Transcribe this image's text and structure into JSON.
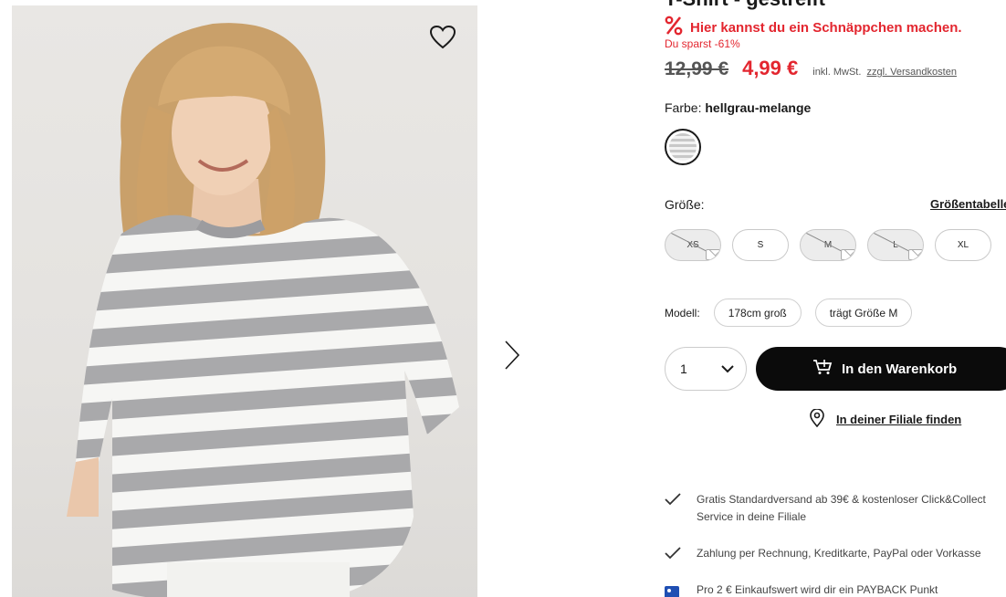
{
  "product": {
    "title": "T-Shirt - gestreift",
    "deal_text": "Hier kannst du ein Schnäppchen machen.",
    "savings": "Du sparst -61%",
    "old_price": "12,99 €",
    "new_price": "4,99 €",
    "tax_note": "inkl. MwSt.",
    "shipping_link": "zzgl. Versandkosten"
  },
  "color": {
    "label": "Farbe:",
    "value": "hellgrau-melange"
  },
  "size": {
    "label": "Größe:",
    "table_link": "Größentabelle",
    "options": [
      {
        "label": "XS",
        "available": false
      },
      {
        "label": "S",
        "available": true
      },
      {
        "label": "M",
        "available": false
      },
      {
        "label": "L",
        "available": false
      },
      {
        "label": "XL",
        "available": true
      }
    ]
  },
  "model": {
    "label": "Modell:",
    "height": "178cm groß",
    "size_worn": "trägt Größe M"
  },
  "cart": {
    "quantity": "1",
    "add_label": "In den Warenkorb",
    "store_link": "In deiner Filiale finden"
  },
  "usps": [
    {
      "icon": "check-icon",
      "text": "Gratis Standardversand ab 39€ & kostenloser Click&Collect Service in deine Filiale"
    },
    {
      "icon": "check-icon",
      "text": "Zahlung per Rechnung, Kreditkarte, PayPal oder Vorkasse"
    },
    {
      "icon": "payback-icon",
      "text": "Pro 2 € Einkaufswert wird dir ein PAYBACK Punkt"
    }
  ],
  "colors": {
    "sale_red": "#e3262f",
    "button_black": "#0b0b0b"
  }
}
